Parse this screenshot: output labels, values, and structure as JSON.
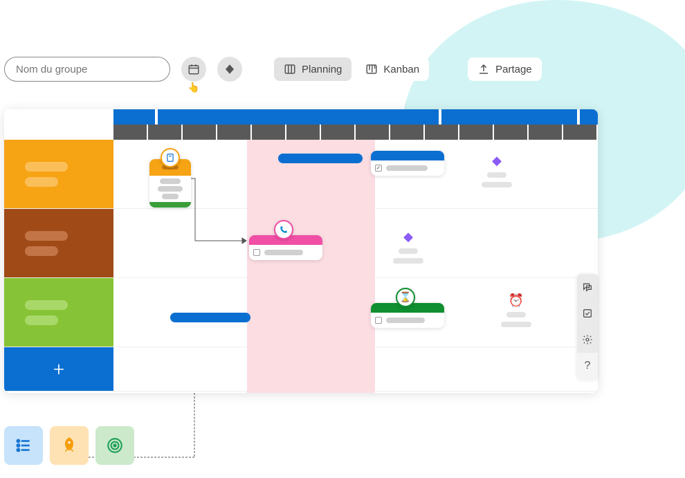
{
  "toolbar": {
    "group_placeholder": "Nom du groupe",
    "calendar_icon": "calendar-icon",
    "milestone_icon": "diamond-icon"
  },
  "tabs": {
    "planning": "Planning",
    "kanban": "Kanban",
    "share": "Partage"
  },
  "rows": [
    {
      "color": "#f6a314"
    },
    {
      "color": "#a04a17"
    },
    {
      "color": "#87c336"
    }
  ],
  "add_row_label": "+",
  "right_rail": {
    "chat": "chat",
    "tasks": "tasks",
    "settings": "settings",
    "help": "?"
  },
  "bottom_tiles": {
    "list": "list-icon",
    "rocket": "rocket-icon",
    "target": "target-icon"
  },
  "accents": {
    "diamond": "◆",
    "clock": "⏰"
  }
}
